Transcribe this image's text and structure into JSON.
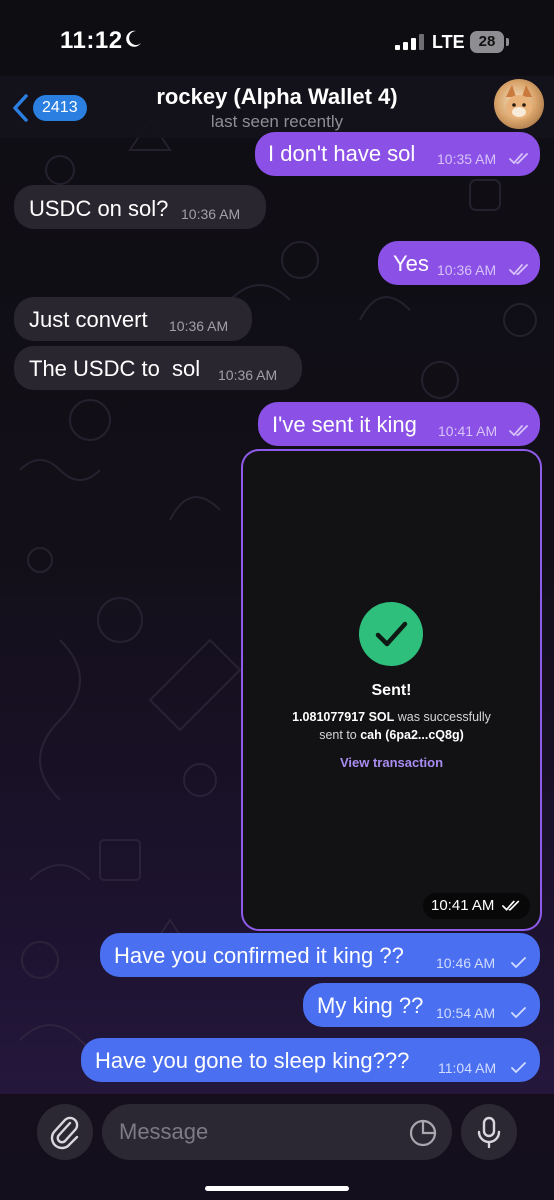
{
  "status_bar": {
    "time": "11:12",
    "network": "LTE",
    "battery": "28"
  },
  "header": {
    "back_count": "2413",
    "title": "rockey (Alpha Wallet 4)",
    "subtitle": "last seen recently"
  },
  "messages": [
    {
      "dir": "out",
      "text": "I don't have sol",
      "time": "10:35 AM",
      "status": "read"
    },
    {
      "dir": "in",
      "text": "USDC on sol?",
      "time": "10:36 AM"
    },
    {
      "dir": "out",
      "text": "Yes",
      "time": "10:36 AM",
      "status": "read"
    },
    {
      "dir": "in",
      "text": "Just convert",
      "time": "10:36 AM"
    },
    {
      "dir": "in",
      "text": "The USDC to  sol",
      "time": "10:36 AM"
    },
    {
      "dir": "out",
      "text": "I've sent it king",
      "time": "10:41 AM",
      "status": "read"
    },
    {
      "dir": "out",
      "text": "Have you confirmed it king ??",
      "time": "10:46 AM",
      "status": "delivered"
    },
    {
      "dir": "out",
      "text": "My king ??",
      "time": "10:54 AM",
      "status": "delivered"
    },
    {
      "dir": "out",
      "text": "Have you gone to sleep king???",
      "time": "11:04 AM",
      "status": "delivered"
    }
  ],
  "image_card": {
    "title": "Sent!",
    "amount": "1.081077917 SOL",
    "line1_rest": " was successfully",
    "line2_pre": "sent to ",
    "recipient": "cah (6pa2...cQ8g)",
    "link": "View transaction",
    "time": "10:41 AM"
  },
  "input": {
    "placeholder": "Message"
  },
  "colors": {
    "outgoing_purple": "#8b50e6",
    "outgoing_blue": "#4a6ff0",
    "incoming": "#2a2630",
    "success_green": "#2fbf7d",
    "link_purple": "#a98cf0"
  },
  "icons": [
    "moon-icon",
    "signal-icon",
    "back-chevron-icon",
    "check-icon",
    "double-check-icon",
    "paperclip-icon",
    "sticker-icon",
    "microphone-icon"
  ]
}
